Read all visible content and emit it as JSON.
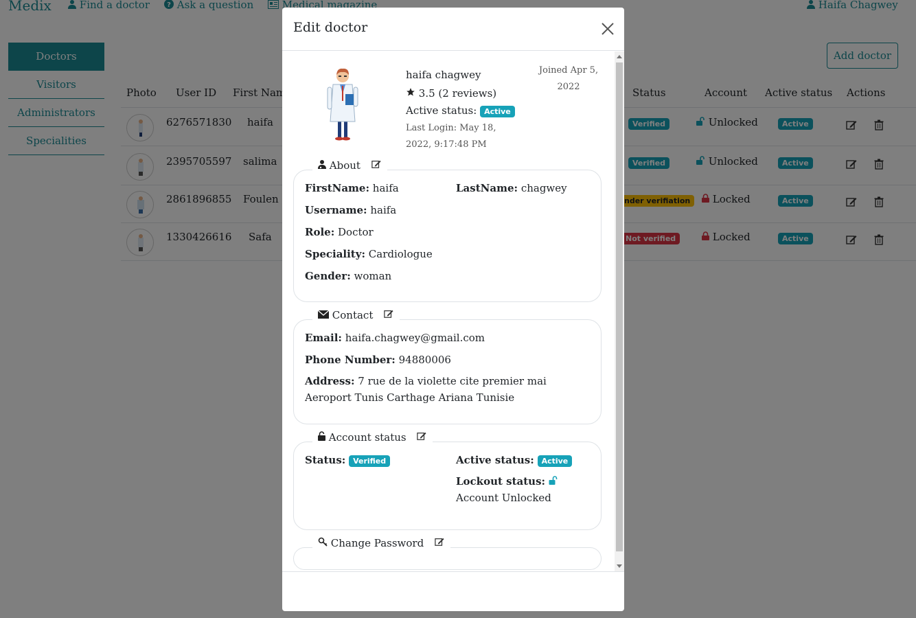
{
  "nav": {
    "brand": "Medix",
    "find_doctor": "Find a doctor",
    "ask_question": "Ask a question",
    "magazine": "Medical magazine",
    "user": "Haifa Chagwey"
  },
  "sidebar": {
    "items": [
      {
        "label": "Doctors"
      },
      {
        "label": "Visitors"
      },
      {
        "label": "Administrators"
      },
      {
        "label": "Specialities"
      }
    ]
  },
  "add_doctor_label": "Add doctor",
  "table": {
    "headers": {
      "photo": "Photo",
      "user_id": "User ID",
      "first_name": "First Name",
      "status": "Status",
      "account": "Account",
      "active_status": "Active status",
      "actions": "Actions"
    },
    "rows": [
      {
        "user_id": "6276571830",
        "first_name": "haifa",
        "status": "Verified",
        "account": "Unlocked",
        "active": "Active"
      },
      {
        "user_id": "2395705597",
        "first_name": "salima",
        "status": "Verified",
        "account": "Unlocked",
        "active": "Active"
      },
      {
        "user_id": "2861896855",
        "first_name": "Foulen",
        "status": "nder verifiation",
        "account": "Locked",
        "active": "Active"
      },
      {
        "user_id": "1330426616",
        "first_name": "Safa",
        "status": "Not verified",
        "account": "Locked",
        "active": "Active"
      }
    ]
  },
  "modal": {
    "title": "Edit doctor",
    "profile": {
      "name": "haifa chagwey",
      "rating": "3.5 (2 reviews)",
      "active_label": "Active status:",
      "active_badge": "Active",
      "last_login": "Last Login: May 18, 2022, 9:17:48 PM",
      "joined": "Joined Apr 5, 2022"
    },
    "about": {
      "legend": "About",
      "first_name_label": "FirstName:",
      "first_name": "haifa",
      "last_name_label": "LastName:",
      "last_name": "chagwey",
      "username_label": "Username:",
      "username": "haifa",
      "role_label": "Role:",
      "role": "Doctor",
      "speciality_label": "Speciality:",
      "speciality": "Cardiologue",
      "gender_label": "Gender:",
      "gender": "woman"
    },
    "contact": {
      "legend": "Contact",
      "email_label": "Email:",
      "email": "haifa.chagwey@gmail.com",
      "phone_label": "Phone Number:",
      "phone": "94880006",
      "address_label": "Address:",
      "address": "7 rue de la violette cite premier mai Aeroport Tunis Carthage Ariana Tunisie"
    },
    "account_status": {
      "legend": "Account status",
      "status_label": "Status:",
      "status_badge": "Verified",
      "active_label": "Active status:",
      "active_badge": "Active",
      "lockout_label": "Lockout status:",
      "lockout_value": "Account Unlocked"
    },
    "change_password": {
      "legend": "Change Password"
    }
  },
  "colors": {
    "primary": "#1a8a94",
    "badge_teal": "#17a2b8",
    "badge_yellow": "#ffc107",
    "badge_red": "#dc3545"
  }
}
